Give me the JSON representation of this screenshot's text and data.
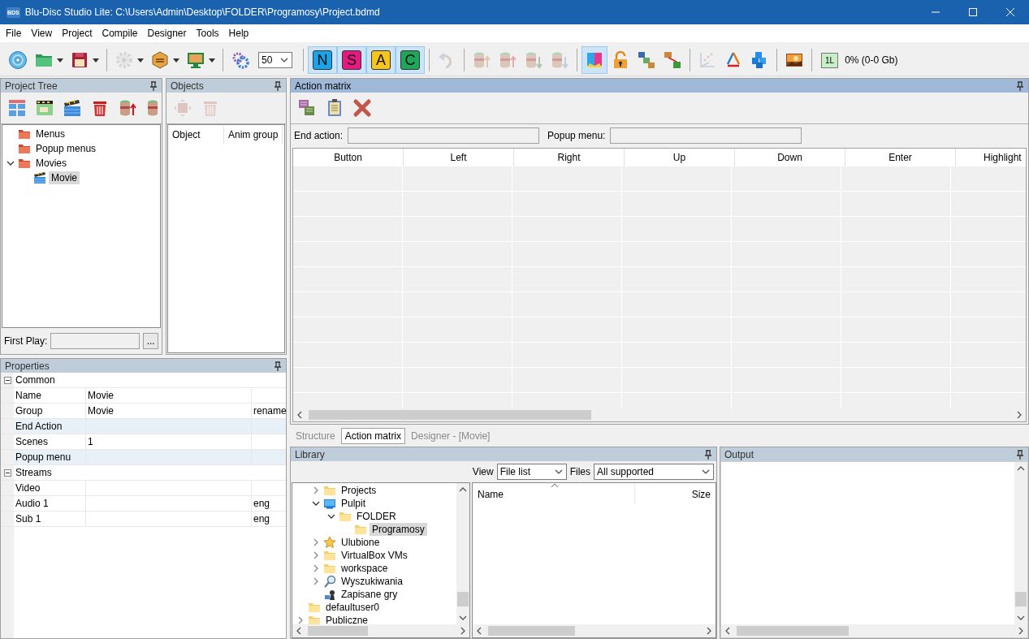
{
  "window": {
    "app_icon": "BDS",
    "title": "Blu-Disc Studio Lite: C:\\Users\\Admin\\Desktop\\FOLDER\\Programosy\\Project.bdmd"
  },
  "menu": [
    "File",
    "View",
    "Project",
    "Compile",
    "Designer",
    "Tools",
    "Help"
  ],
  "toolbar": [
    {
      "kind": "button",
      "disabled": false
    },
    {
      "kind": "button",
      "disabled": false,
      "dropdown": true
    },
    {
      "kind": "button",
      "disabled": false,
      "dropdown": true
    },
    {
      "kind": "separator"
    },
    {
      "kind": "button",
      "disabled": true,
      "dropdown": true
    },
    {
      "kind": "button",
      "disabled": false,
      "dropdown": true
    },
    {
      "kind": "button",
      "disabled": false,
      "dropdown": true
    },
    {
      "kind": "separator"
    },
    {
      "kind": "button",
      "disabled": false
    },
    {
      "kind": "select",
      "value": "50"
    },
    {
      "kind": "separator"
    },
    {
      "kind": "toggle",
      "label": "N",
      "color": "#1aa3e8",
      "selected": true
    },
    {
      "kind": "toggle",
      "label": "S",
      "color": "#e5197f",
      "selected": true
    },
    {
      "kind": "toggle",
      "label": "A",
      "color": "#f6c61c",
      "selected": true
    },
    {
      "kind": "toggle",
      "label": "C",
      "color": "#20a65a",
      "selected": true
    },
    {
      "kind": "separator"
    },
    {
      "kind": "button",
      "disabled": true
    },
    {
      "kind": "separator"
    },
    {
      "kind": "button",
      "disabled": true
    },
    {
      "kind": "button",
      "disabled": true
    },
    {
      "kind": "button",
      "disabled": true
    },
    {
      "kind": "button",
      "disabled": true
    },
    {
      "kind": "separator"
    },
    {
      "kind": "button",
      "disabled": false,
      "selected": true
    },
    {
      "kind": "button",
      "disabled": false,
      "selected": false
    },
    {
      "kind": "button",
      "disabled": false,
      "selected": false
    },
    {
      "kind": "button",
      "disabled": false,
      "selected": false
    },
    {
      "kind": "separator"
    },
    {
      "kind": "button",
      "disabled": true
    },
    {
      "kind": "button",
      "disabled": false
    },
    {
      "kind": "button",
      "disabled": false
    },
    {
      "kind": "separator"
    },
    {
      "kind": "button",
      "disabled": false
    },
    {
      "kind": "separator"
    },
    {
      "kind": "badge",
      "label": "1L"
    },
    {
      "kind": "text",
      "label": "0% (0-0 Gb)"
    }
  ],
  "project_tree": {
    "title": "Project Tree",
    "tools": [
      {
        "disabled": false
      },
      {
        "disabled": false
      },
      {
        "disabled": false
      },
      {
        "disabled": false
      },
      {
        "disabled": false
      },
      {
        "disabled": false
      }
    ],
    "items": [
      {
        "label": "Menus",
        "kind": "folder",
        "selected": false
      },
      {
        "label": "Popup menus",
        "kind": "folder",
        "selected": false
      },
      {
        "label": "Movies",
        "kind": "folder",
        "selected": false,
        "expanded": true,
        "children": [
          {
            "label": "Movie",
            "kind": "movie",
            "selected": true
          }
        ]
      }
    ],
    "first_play": {
      "label": "First Play:",
      "button": "..."
    }
  },
  "objects": {
    "title": "Objects",
    "tools": [
      {
        "disabled": true
      },
      {
        "disabled": true
      }
    ],
    "columns": [
      "Object",
      "Anim group"
    ]
  },
  "properties": {
    "title": "Properties",
    "groups": [
      {
        "label": "Common",
        "expanded": true,
        "rows": [
          {
            "name": "Name",
            "value": "Movie",
            "highlighted": false
          },
          {
            "name": "Group",
            "value": "Movie",
            "extra": "rename",
            "highlighted": false
          },
          {
            "name": "End Action",
            "highlighted": true
          },
          {
            "name": "Scenes",
            "value": "1",
            "highlighted": false
          },
          {
            "name": "Popup menu",
            "highlighted": true
          }
        ]
      },
      {
        "label": "Streams",
        "expanded": true,
        "rows": [
          {
            "name": "Video",
            "highlighted": false
          },
          {
            "name": "Audio 1",
            "extra": "eng",
            "highlighted": false
          },
          {
            "name": "Sub 1",
            "extra": "eng",
            "highlighted": false
          }
        ]
      }
    ]
  },
  "action_matrix": {
    "title": "Action matrix",
    "tools": [
      {
        "disabled": false
      },
      {
        "disabled": false
      },
      {
        "disabled": false
      }
    ],
    "end_action_label": "End action:",
    "popup_menu_label": "Popup menu:",
    "columns": [
      "Button",
      "Left",
      "Right",
      "Up",
      "Down",
      "Enter",
      "Highlight"
    ]
  },
  "tabs": [
    {
      "label": "Structure",
      "selected": false,
      "disabled": true
    },
    {
      "label": "Action matrix",
      "selected": true,
      "disabled": false
    },
    {
      "label": "Designer - [Movie]",
      "selected": false,
      "disabled": true
    }
  ],
  "library": {
    "title": "Library",
    "view_label": "View",
    "view": "File list",
    "files_label": "Files",
    "files": "All supported",
    "tree": [
      {
        "children": [
          {
            "label": "Projects",
            "kind": "folder",
            "selected": false,
            "expanded": false
          },
          {
            "label": "Pulpit",
            "kind": "desktop",
            "selected": false,
            "expanded": true,
            "children": [
              {
                "label": "FOLDER",
                "kind": "folder",
                "selected": false,
                "expanded": true,
                "children": [
                  {
                    "label": "Programosy",
                    "kind": "folder",
                    "selected": true
                  }
                ]
              }
            ]
          },
          {
            "label": "Ulubione",
            "kind": "star",
            "selected": false,
            "expanded": false
          },
          {
            "label": "VirtualBox VMs",
            "kind": "folder",
            "selected": false,
            "expanded": false
          },
          {
            "label": "workspace",
            "kind": "folder",
            "selected": false,
            "expanded": false
          },
          {
            "label": "Wyszukiwania",
            "kind": "search",
            "selected": false,
            "expanded": false
          },
          {
            "label": "Zapisane gry",
            "kind": "game",
            "selected": false
          }
        ]
      },
      {
        "label": "defaultuser0",
        "kind": "folder",
        "selected": false
      },
      {
        "label": "Publiczne",
        "kind": "folder",
        "selected": false,
        "expanded": false
      }
    ],
    "file_columns": [
      {
        "label": "Name",
        "sorted": true
      },
      {
        "label": "Size",
        "sorted": false
      }
    ]
  },
  "output": {
    "title": "Output"
  }
}
